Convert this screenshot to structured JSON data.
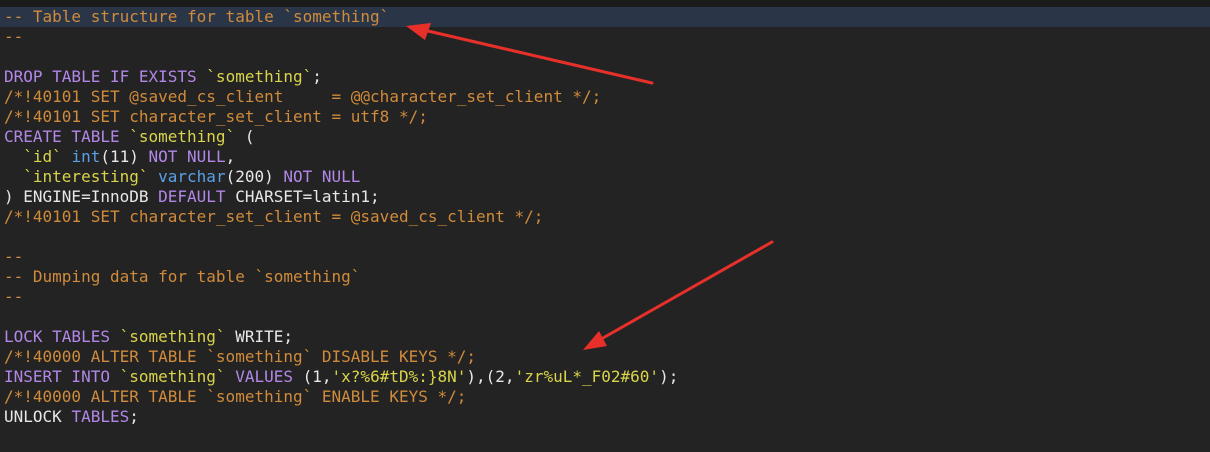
{
  "editor": {
    "highlighted_line": 0,
    "lines": [
      [
        {
          "t": "comment",
          "text": "-- Table structure for table `something`"
        }
      ],
      [
        {
          "t": "comment",
          "text": "--"
        }
      ],
      [],
      [
        {
          "t": "keyword",
          "text": "DROP TABLE IF EXISTS "
        },
        {
          "t": "string",
          "text": "`something`"
        },
        {
          "t": "plain",
          "text": ";"
        }
      ],
      [
        {
          "t": "comment",
          "text": "/*!40101 SET @saved_cs_client     = @@character_set_client */;"
        }
      ],
      [
        {
          "t": "comment",
          "text": "/*!40101 SET character_set_client = utf8 */;"
        }
      ],
      [
        {
          "t": "keyword",
          "text": "CREATE TABLE "
        },
        {
          "t": "string",
          "text": "`something`"
        },
        {
          "t": "plain",
          "text": " ("
        }
      ],
      [
        {
          "t": "plain",
          "text": "  "
        },
        {
          "t": "string",
          "text": "`id`"
        },
        {
          "t": "plain",
          "text": " "
        },
        {
          "t": "type",
          "text": "int"
        },
        {
          "t": "plain",
          "text": "(11) "
        },
        {
          "t": "keyword",
          "text": "NOT NULL"
        },
        {
          "t": "plain",
          "text": ","
        }
      ],
      [
        {
          "t": "plain",
          "text": "  "
        },
        {
          "t": "string",
          "text": "`interesting`"
        },
        {
          "t": "plain",
          "text": " "
        },
        {
          "t": "type",
          "text": "varchar"
        },
        {
          "t": "plain",
          "text": "(200) "
        },
        {
          "t": "keyword",
          "text": "NOT NULL"
        }
      ],
      [
        {
          "t": "plain",
          "text": ") ENGINE=InnoDB "
        },
        {
          "t": "keyword",
          "text": "DEFAULT"
        },
        {
          "t": "plain",
          "text": " CHARSET=latin1;"
        }
      ],
      [
        {
          "t": "comment",
          "text": "/*!40101 SET character_set_client = @saved_cs_client */;"
        }
      ],
      [],
      [
        {
          "t": "comment",
          "text": "--"
        }
      ],
      [
        {
          "t": "comment",
          "text": "-- Dumping data for table `something`"
        }
      ],
      [
        {
          "t": "comment",
          "text": "--"
        }
      ],
      [],
      [
        {
          "t": "keyword",
          "text": "LOCK TABLES "
        },
        {
          "t": "string",
          "text": "`something`"
        },
        {
          "t": "plain",
          "text": " WRITE;"
        }
      ],
      [
        {
          "t": "comment",
          "text": "/*!40000 ALTER TABLE `something` DISABLE KEYS */;"
        }
      ],
      [
        {
          "t": "keyword",
          "text": "INSERT INTO "
        },
        {
          "t": "string",
          "text": "`something`"
        },
        {
          "t": "plain",
          "text": " "
        },
        {
          "t": "keyword",
          "text": "VALUES"
        },
        {
          "t": "plain",
          "text": " (1,"
        },
        {
          "t": "string",
          "text": "'x?%6#tD%:}8N'"
        },
        {
          "t": "plain",
          "text": "),(2,"
        },
        {
          "t": "string",
          "text": "'zr%uL*_F02#60'"
        },
        {
          "t": "plain",
          "text": ");"
        }
      ],
      [
        {
          "t": "comment",
          "text": "/*!40000 ALTER TABLE `something` ENABLE KEYS */;"
        }
      ],
      [
        {
          "t": "plain",
          "text": "UNLOCK "
        },
        {
          "t": "keyword",
          "text": "TABLES"
        },
        {
          "t": "plain",
          "text": ";"
        }
      ]
    ]
  },
  "colors": {
    "background": "#232323",
    "comment": "#d08b3b",
    "keyword": "#b387e8",
    "string": "#d9d44a",
    "type": "#5aa0e6",
    "plain": "#e8e8e8",
    "line_highlight": "#2a3648",
    "annotation_arrow": "#e8302a"
  },
  "annotations": [
    {
      "icon": "red-arrow-icon",
      "points_to": "-- Table structure for table `something`"
    },
    {
      "icon": "red-arrow-icon",
      "points_to": "INSERT INTO `something` VALUES (1,'x?%6#tD%:}8N'),(2,'zr%uL*_F02#60');"
    }
  ]
}
